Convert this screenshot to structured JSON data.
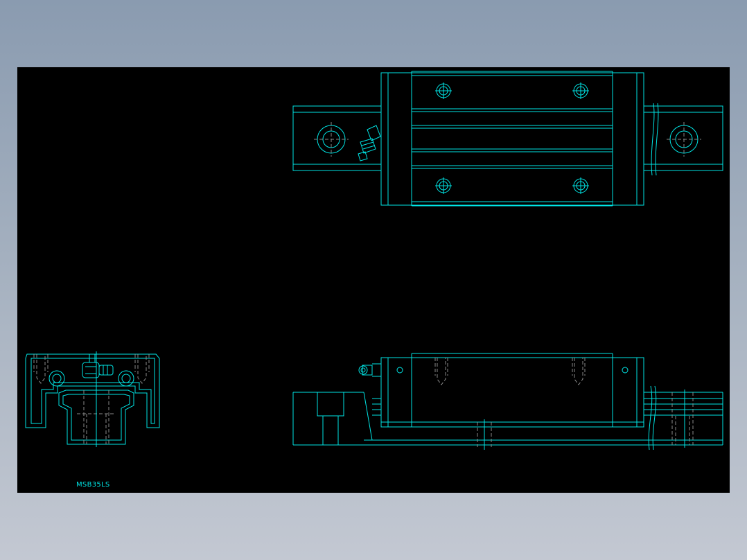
{
  "drawing": {
    "part_label": "MSB35LS",
    "colors": {
      "background": "#000000",
      "line": "#00e5e5",
      "hidden_line": "#8a8a8a",
      "text": "#00e5e5"
    },
    "views": [
      "top-view",
      "side-view",
      "end-view"
    ]
  }
}
